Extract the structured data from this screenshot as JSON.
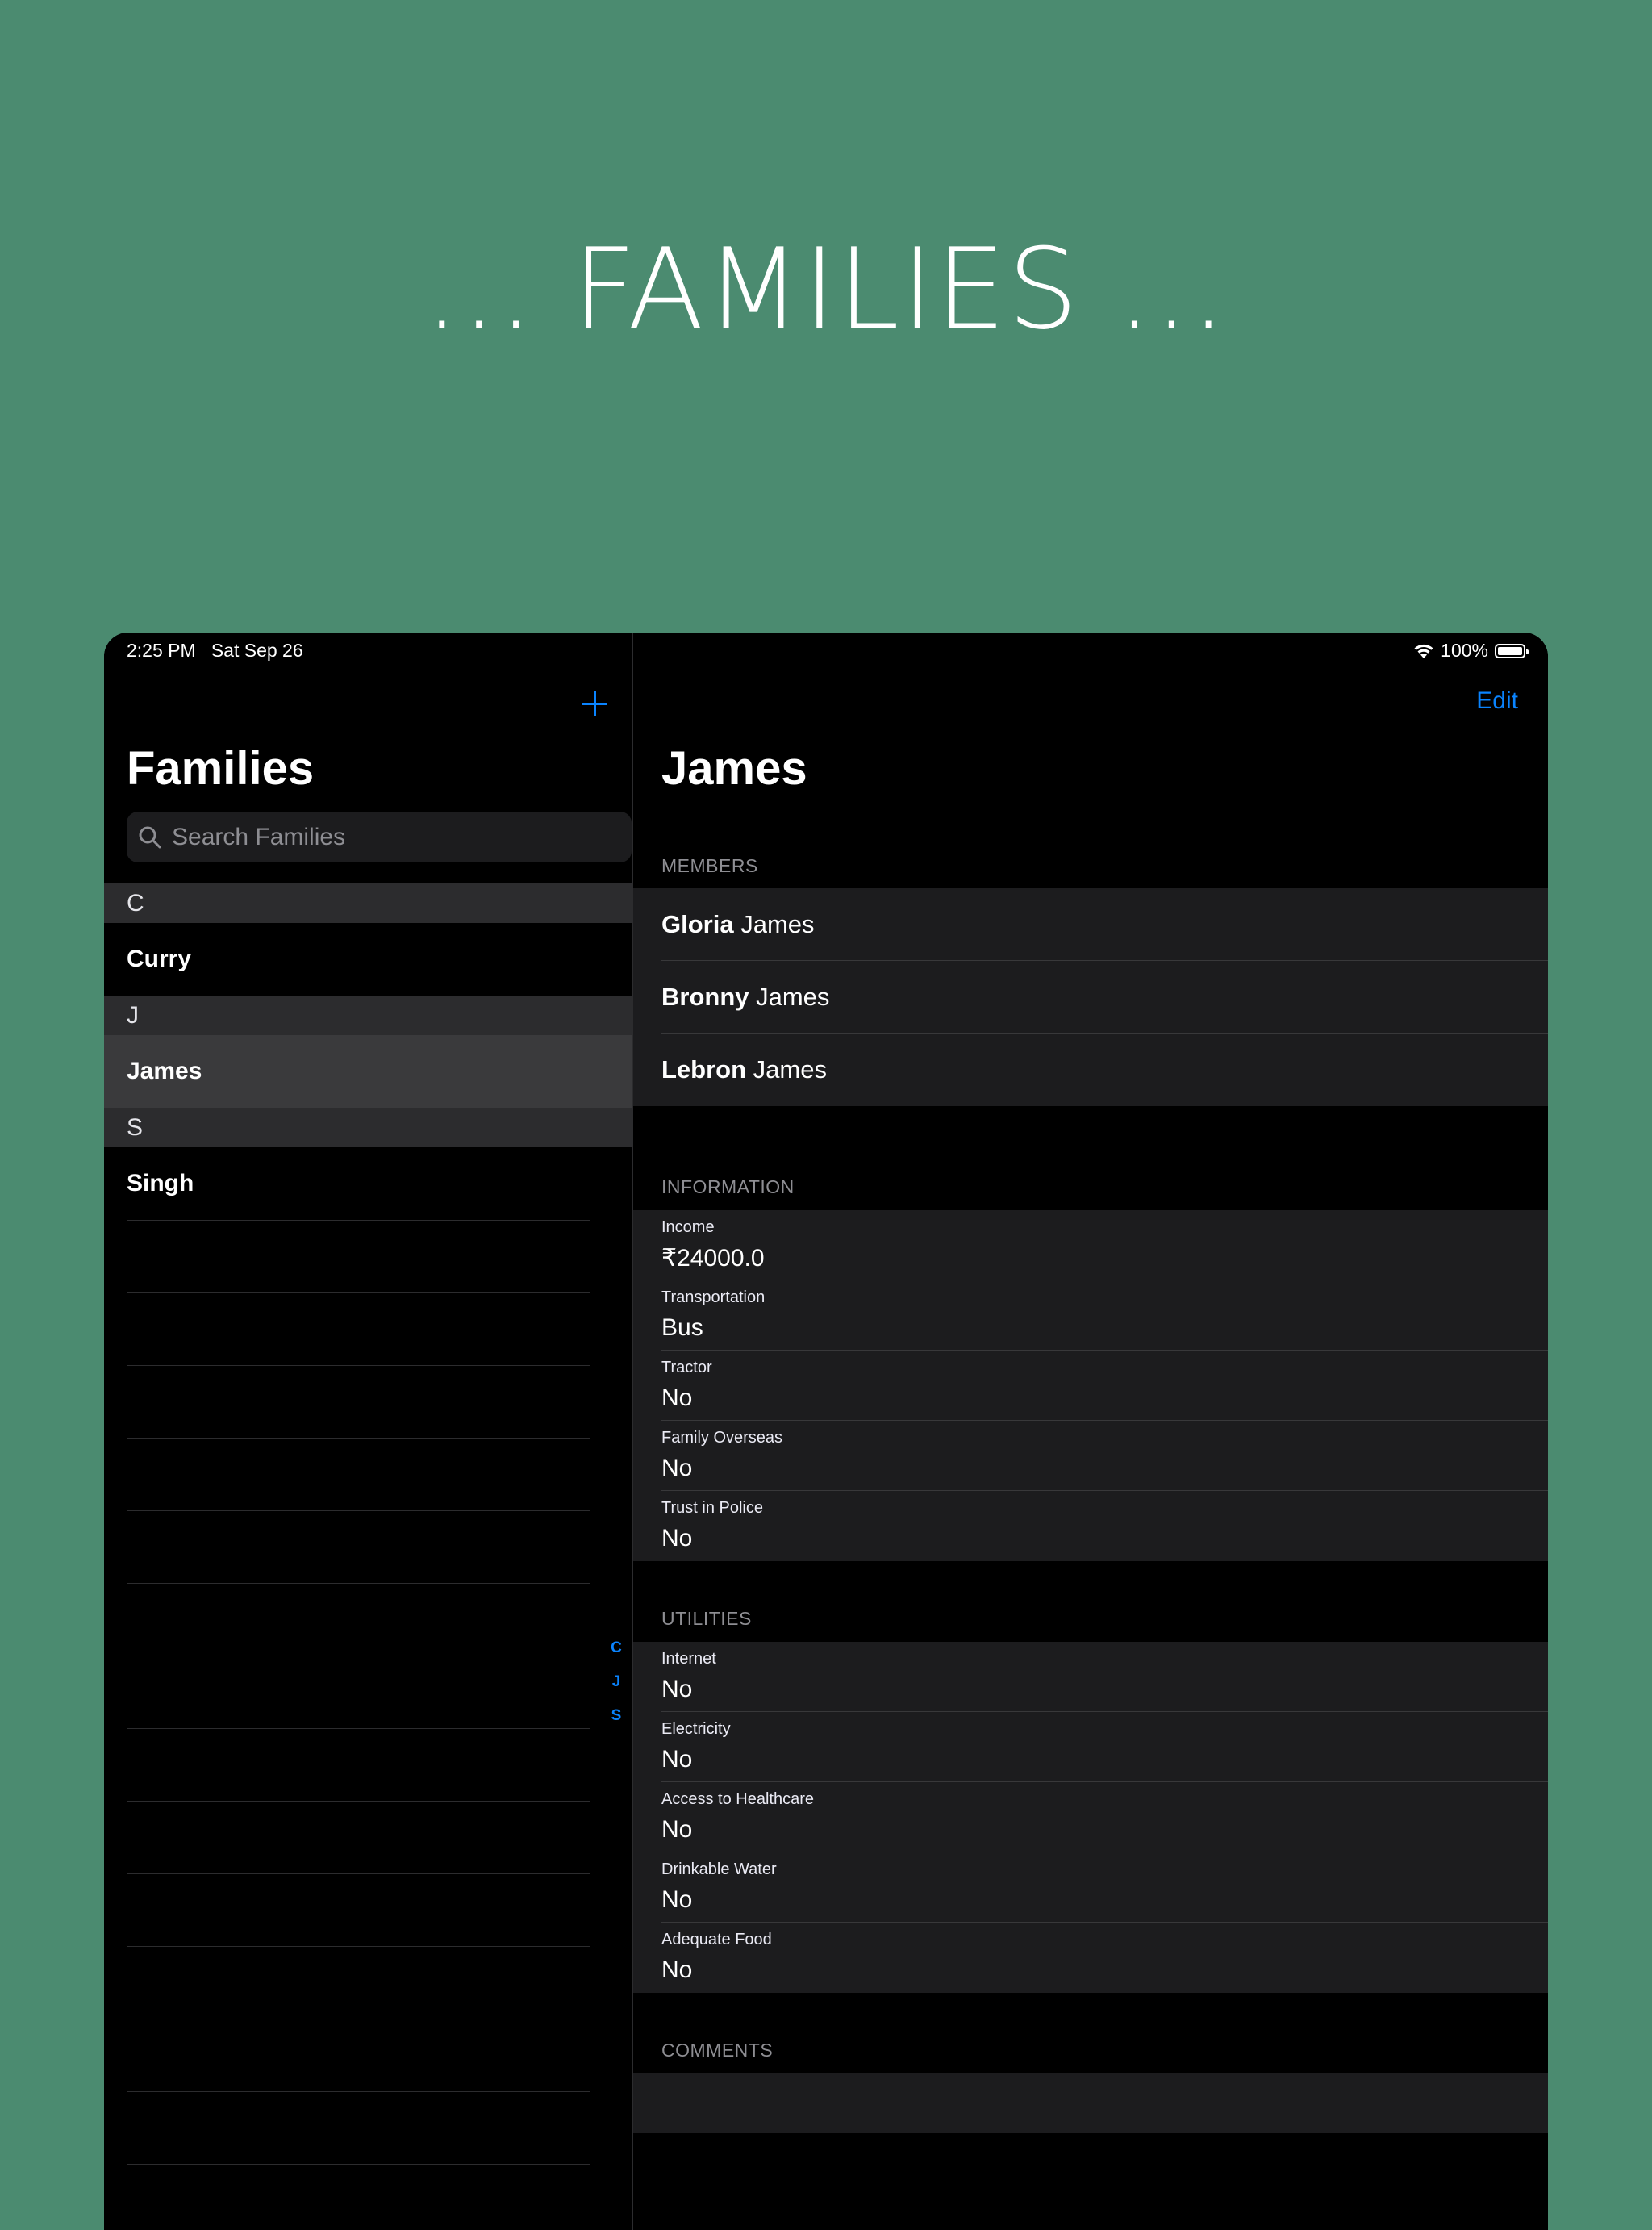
{
  "headline": "... FAMILIES ...",
  "status": {
    "time": "2:25 PM   Sat Sep 26",
    "battery": "100%",
    "battery_level": 1.0
  },
  "master": {
    "title": "Families",
    "add_icon": "plus-icon",
    "search_placeholder": "Search Families",
    "sections": [
      {
        "letter": "C",
        "items": [
          "Curry"
        ]
      },
      {
        "letter": "J",
        "items": [
          "James"
        ]
      },
      {
        "letter": "S",
        "items": [
          "Singh"
        ]
      }
    ],
    "selected": "James",
    "index": [
      "C",
      "J",
      "S"
    ]
  },
  "detail": {
    "edit_label": "Edit",
    "title": "James",
    "members_header": "MEMBERS",
    "members": [
      {
        "first": "Gloria",
        "last": "James"
      },
      {
        "first": "Bronny",
        "last": "James"
      },
      {
        "first": "Lebron",
        "last": "James"
      }
    ],
    "information_header": "INFORMATION",
    "information": [
      {
        "label": "Income",
        "value": "₹24000.0"
      },
      {
        "label": "Transportation",
        "value": "Bus"
      },
      {
        "label": "Tractor",
        "value": "No"
      },
      {
        "label": "Family Overseas",
        "value": "No"
      },
      {
        "label": "Trust in Police",
        "value": "No"
      }
    ],
    "utilities_header": "UTILITIES",
    "utilities": [
      {
        "label": "Internet",
        "value": "No"
      },
      {
        "label": "Electricity",
        "value": "No"
      },
      {
        "label": "Access to Healthcare",
        "value": "No"
      },
      {
        "label": "Drinkable Water",
        "value": "No"
      },
      {
        "label": "Adequate Food",
        "value": "No"
      }
    ],
    "comments_header": "COMMENTS"
  },
  "colors": {
    "background": "#4b8b70",
    "accent": "#0a84ff"
  }
}
